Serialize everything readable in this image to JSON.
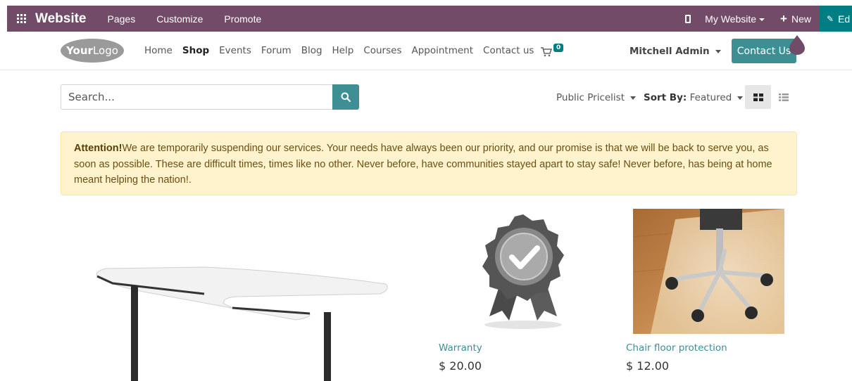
{
  "admin_bar": {
    "brand": "Website",
    "menu": [
      "Pages",
      "Customize",
      "Promote"
    ],
    "website_switch": "My Website",
    "new_label": "New",
    "edit_label": "Ed"
  },
  "site_nav": {
    "logo_bold": "Your",
    "logo_rest": "Logo",
    "links": [
      "Home",
      "Shop",
      "Events",
      "Forum",
      "Blog",
      "Help",
      "Courses",
      "Appointment",
      "Contact us"
    ],
    "active_link": "Shop",
    "cart_count": "0",
    "user_name": "Mitchell Admin",
    "contact_button": "Contact Us"
  },
  "search": {
    "placeholder": "Search..."
  },
  "filters": {
    "pricelist": "Public Pricelist",
    "sort_label": "Sort By:",
    "sort_value": "Featured"
  },
  "alert": {
    "title": "Attention!",
    "message": "We are temporarily suspending our services. Your needs have always been our priority, and our promise is that we will be back to serve you, as soon as possible. These are difficult times, times like no other. Never before, have communities stayed apart to stay safe! Never before, has being at home meant helping the nation!."
  },
  "products": [
    {
      "name": "Warranty",
      "price": "$ 20.00"
    },
    {
      "name": "Chair floor protection",
      "price": "$ 12.00"
    }
  ],
  "colors": {
    "admin_bar": "#714b67",
    "primary": "#3d8f94",
    "edit_bg": "#017e84",
    "alert_bg": "#fff3cd"
  }
}
